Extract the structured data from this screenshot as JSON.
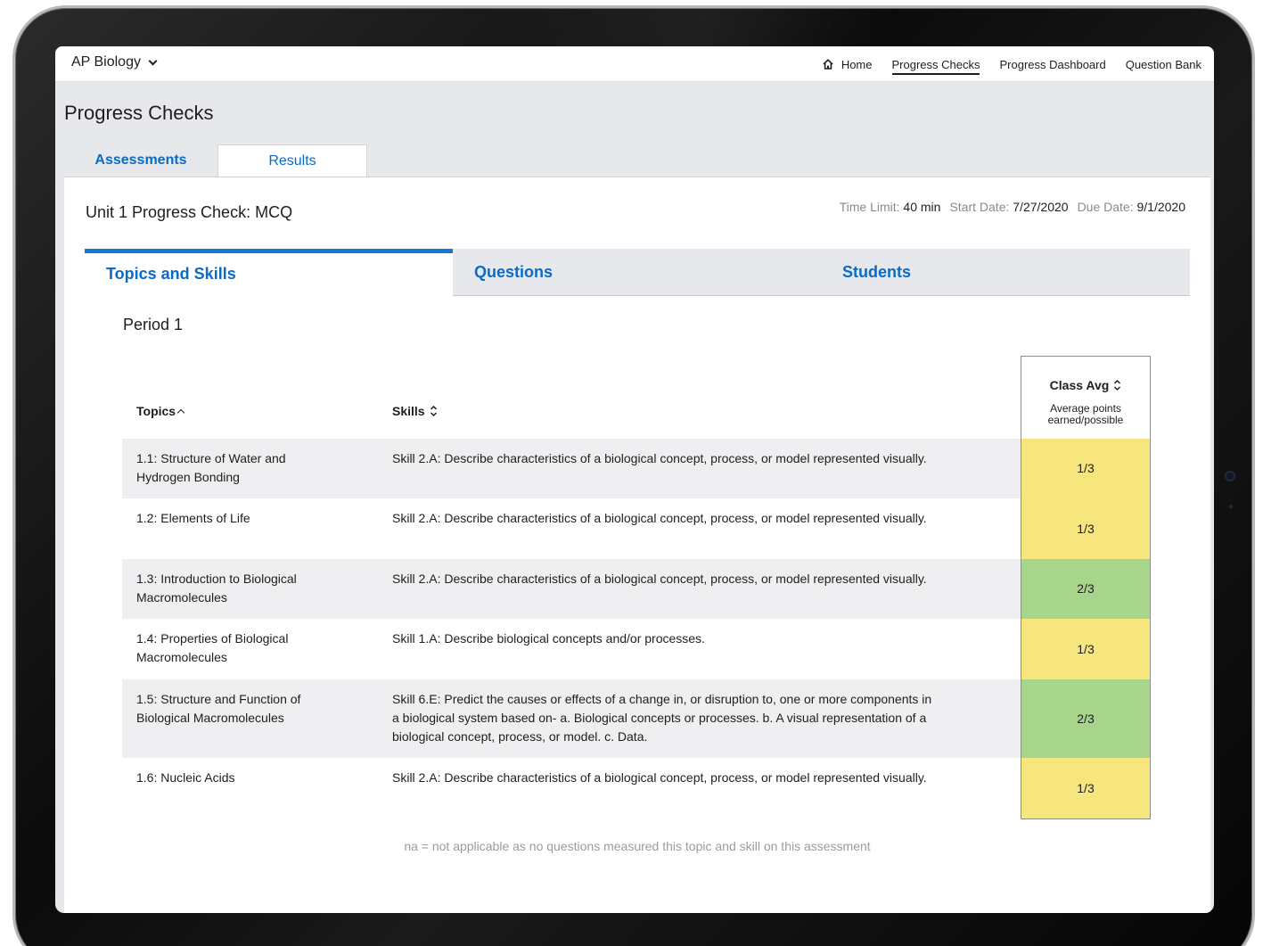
{
  "nav": {
    "course": "AP Biology",
    "links": [
      {
        "label": "Home",
        "icon": "home-icon"
      },
      {
        "label": "Progress Checks",
        "active": true
      },
      {
        "label": "Progress Dashboard"
      },
      {
        "label": "Question Bank"
      }
    ]
  },
  "page": {
    "title": "Progress Checks",
    "tabs": [
      {
        "label": "Assessments"
      },
      {
        "label": "Results",
        "active": true
      }
    ]
  },
  "assessment": {
    "title": "Unit 1 Progress Check: MCQ",
    "time_limit_label": "Time Limit:",
    "time_limit": "40 min",
    "start_date_label": "Start Date:",
    "start_date": "7/27/2020",
    "due_date_label": "Due Date:",
    "due_date": "9/1/2020"
  },
  "result_tabs": [
    {
      "label": "Topics and Skills",
      "active": true
    },
    {
      "label": "Questions"
    },
    {
      "label": "Students"
    }
  ],
  "period": "Period 1",
  "table": {
    "headers": {
      "topics": "Topics",
      "skills": "Skills",
      "class_avg": "Class Avg",
      "class_avg_sub_1": "Average points",
      "class_avg_sub_2": "earned/possible"
    },
    "rows": [
      {
        "topic_1": "1.1: Structure of Water and",
        "topic_2": "Hydrogen Bonding",
        "skill": "Skill 2.A: Describe characteristics of a biological concept, process, or model represented visually.",
        "avg": "1/3",
        "level": "yellow"
      },
      {
        "topic_1": "1.2: Elements of Life",
        "topic_2": "",
        "skill": "Skill 2.A: Describe characteristics of a biological concept, process, or model represented visually.",
        "avg": "1/3",
        "level": "yellow"
      },
      {
        "topic_1": "1.3: Introduction to Biological",
        "topic_2": "Macromolecules",
        "skill": "Skill 2.A: Describe characteristics of a biological concept, process, or model represented visually.",
        "avg": "2/3",
        "level": "green"
      },
      {
        "topic_1": "1.4: Properties of Biological",
        "topic_2": "Macromolecules",
        "skill": "Skill 1.A: Describe biological concepts and/or processes.",
        "avg": "1/3",
        "level": "yellow"
      },
      {
        "topic_1": "1.5: Structure and Function of",
        "topic_2": "Biological Macromolecules",
        "skill_1": "Skill 6.E: Predict the causes or effects of a change in, or disruption to, one or more components in",
        "skill_2": "a biological system based on- a. Biological concepts or processes. b. A visual representation of a",
        "skill_3": "biological concept, process, or model. c. Data.",
        "avg": "2/3",
        "level": "green"
      },
      {
        "topic_1": "1.6: Nucleic Acids",
        "topic_2": "",
        "skill": "Skill 2.A: Describe characteristics of a biological concept, process, or model represented visually.",
        "avg": "1/3",
        "level": "yellow"
      }
    ]
  },
  "footnote": "na = not applicable as no questions measured this topic and skill on this assessment",
  "colors": {
    "accent": "#1677d8",
    "link": "#0a6bc7",
    "avg_low": "#f7e57e",
    "avg_mid": "#a7d58c"
  }
}
